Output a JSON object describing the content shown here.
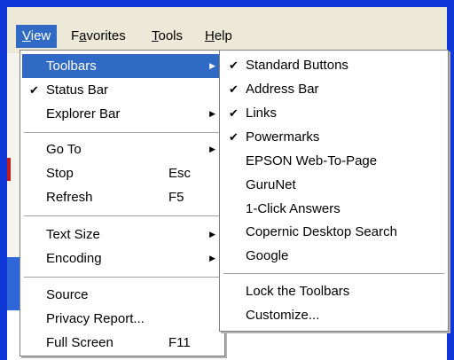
{
  "menubar": {
    "items": [
      {
        "label": "View",
        "access": "V",
        "rest": "iew",
        "active": true
      },
      {
        "label": "Favorites",
        "access": "a",
        "pre": "F",
        "rest": "vorites"
      },
      {
        "label": "Tools",
        "access": "T",
        "rest": "ools"
      },
      {
        "label": "Help",
        "access": "H",
        "rest": "elp"
      }
    ]
  },
  "view_menu": {
    "toolbars": "Toolbars",
    "status_bar": "Status Bar",
    "explorer_bar": "Explorer Bar",
    "go_to": "Go To",
    "stop": "Stop",
    "stop_shortcut": "Esc",
    "refresh": "Refresh",
    "refresh_shortcut": "F5",
    "text_size": "Text Size",
    "encoding": "Encoding",
    "source": "Source",
    "privacy_report": "Privacy Report...",
    "full_screen": "Full Screen",
    "full_screen_shortcut": "F11"
  },
  "toolbars_menu": {
    "standard_buttons": "Standard Buttons",
    "address_bar": "Address Bar",
    "links": "Links",
    "powermarks": "Powermarks",
    "epson": "EPSON Web-To-Page",
    "gurunet": "GuruNet",
    "one_click": "1-Click Answers",
    "copernic": "Copernic Desktop Search",
    "google": "Google",
    "lock": "Lock the Toolbars",
    "customize": "Customize..."
  },
  "glyphs": {
    "check": "✔",
    "arrow": "▶"
  },
  "colors": {
    "frame": "#1038d8",
    "highlight": "#316ac5",
    "menubar": "#ece9d8"
  }
}
